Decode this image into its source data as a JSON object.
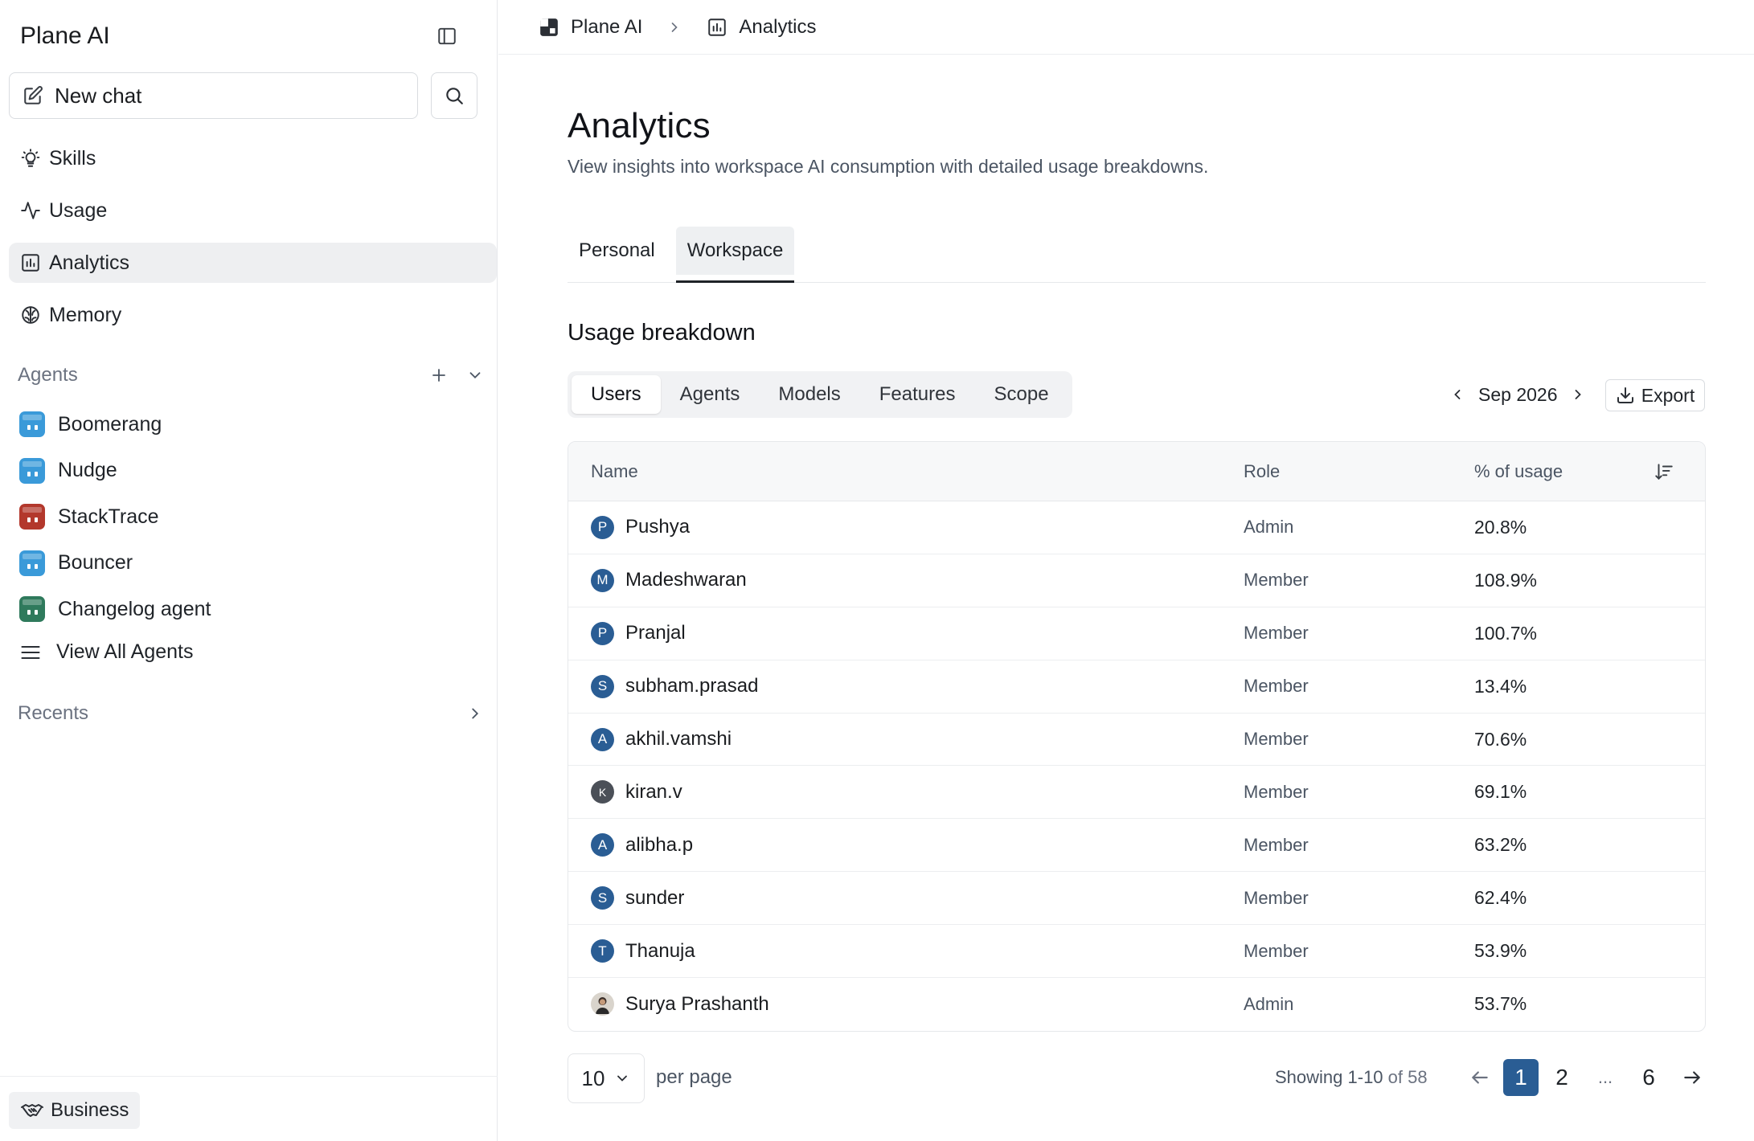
{
  "app": {
    "title": "Plane AI"
  },
  "sidebar": {
    "new_chat_label": "New chat",
    "nav": [
      {
        "label": "Skills",
        "icon": "lightbulb-icon"
      },
      {
        "label": "Usage",
        "icon": "activity-icon"
      },
      {
        "label": "Analytics",
        "icon": "chart-icon",
        "active": true
      },
      {
        "label": "Memory",
        "icon": "brain-icon"
      }
    ],
    "agents_label": "Agents",
    "agents": [
      {
        "name": "Boomerang",
        "color": "#3a9ad9"
      },
      {
        "name": "Nudge",
        "color": "#3a9ad9"
      },
      {
        "name": "StackTrace",
        "color": "#b3382c"
      },
      {
        "name": "Bouncer",
        "color": "#3a9ad9"
      },
      {
        "name": "Changelog agent",
        "color": "#2f7a5c"
      }
    ],
    "view_all_label": "View All Agents",
    "recents_label": "Recents",
    "plan_label": "Business"
  },
  "breadcrumb": {
    "root": "Plane AI",
    "current": "Analytics"
  },
  "page": {
    "title": "Analytics",
    "subtitle": "View insights into workspace AI consumption with detailed usage breakdowns.",
    "tabs": [
      "Personal",
      "Workspace"
    ],
    "active_tab": "Workspace",
    "section_title": "Usage breakdown",
    "segments": [
      "Users",
      "Agents",
      "Models",
      "Features",
      "Scope"
    ],
    "active_segment": "Users",
    "month": "Sep 2026",
    "export_label": "Export"
  },
  "table": {
    "headers": {
      "name": "Name",
      "role": "Role",
      "usage": "% of usage"
    },
    "rows": [
      {
        "initial": "P",
        "name": "Pushya",
        "role": "Admin",
        "usage": "20.8%"
      },
      {
        "initial": "M",
        "name": "Madeshwaran",
        "role": "Member",
        "usage": "108.9%"
      },
      {
        "initial": "P",
        "name": "Pranjal",
        "role": "Member",
        "usage": "100.7%"
      },
      {
        "initial": "S",
        "name": "subham.prasad",
        "role": "Member",
        "usage": "13.4%"
      },
      {
        "initial": "A",
        "name": "akhil.vamshi",
        "role": "Member",
        "usage": "70.6%"
      },
      {
        "initial": "K",
        "name": "kiran.v",
        "role": "Member",
        "usage": "69.1%"
      },
      {
        "initial": "A",
        "name": "alibha.p",
        "role": "Member",
        "usage": "63.2%"
      },
      {
        "initial": "S",
        "name": "sunder",
        "role": "Member",
        "usage": "62.4%"
      },
      {
        "initial": "T",
        "name": "Thanuja",
        "role": "Member",
        "usage": "53.9%"
      },
      {
        "initial": "",
        "name": "Surya Prashanth",
        "role": "Admin",
        "usage": "53.7%"
      }
    ]
  },
  "pagination": {
    "per_page": "10",
    "per_page_label": "per page",
    "showing_prefix": "Showing 1-10",
    "showing_suffix": "of 58",
    "pages": [
      "1",
      "2",
      "...",
      "6"
    ],
    "current_page": "1"
  },
  "colors": {
    "accent": "#2a5d94",
    "active_bg": "#eeeff1"
  }
}
